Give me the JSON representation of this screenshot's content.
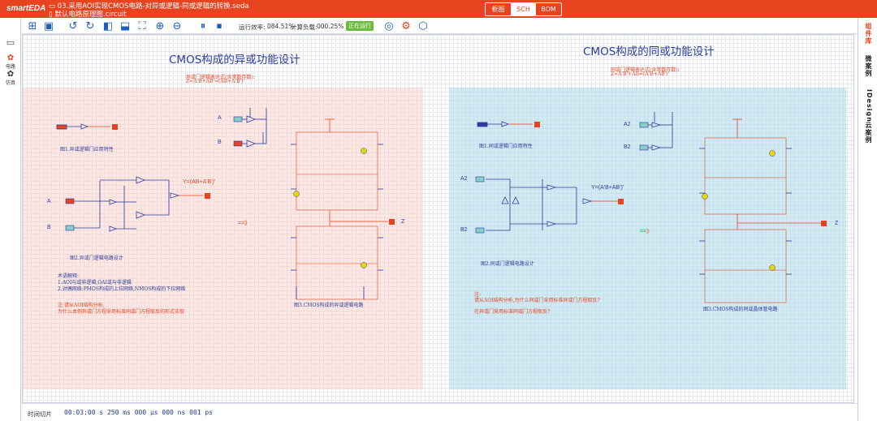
{
  "app": {
    "logo": "smartEDA",
    "file_path": "03.采用AOI实现CMOS电路-对异或逻辑-同或逻辑的转换.seda",
    "circuit_name": "默认电路原理图.circuit",
    "accent": "#e8431f"
  },
  "modes": [
    "框图",
    "SCH",
    "BOM"
  ],
  "toolbar": {
    "icons": [
      "new-file-icon",
      "save-icon",
      "rotate-ccw-icon",
      "rotate-cw-icon",
      "flip-h-icon",
      "flip-v-icon",
      "fit-icon",
      "zoom-in-icon",
      "zoom-out-icon",
      "pause-icon",
      "stop-icon",
      "settings-icon",
      "robot-icon",
      "cube-icon"
    ],
    "efficiency_label": "运行效率:",
    "efficiency_value": "084.51%",
    "load_label": "计算负载:",
    "load_value": "000.25%",
    "run_status": "正在运行"
  },
  "leftbar": {
    "items": [
      {
        "label": ""
      },
      {
        "label": "电路"
      },
      {
        "label": "仿真"
      }
    ]
  },
  "rightbar": {
    "items": [
      "组件库",
      "微案例",
      "IDesign",
      "云案例"
    ]
  },
  "left_panel": {
    "title": "CMOS构成的异或功能设计",
    "expr_label": "异或门逻辑表达式(含常数存数):",
    "expr": "Z=A'B+AB'=(AB+A'B')'",
    "fig1": "图1.异或逻辑门应用特性",
    "fig2": "图2.异或门逻辑电路设计",
    "fig3": "图3.CMOS构成的异或逻辑电路",
    "y_label": "Y=(AB+A'B')'",
    "arrow": "==》",
    "sig_a": "A",
    "sig_b": "B",
    "sig_z": "Z",
    "one": "1",
    "note_title": "术语解释:",
    "note1": "1.AOI与或非逻辑,OAI或与非逻辑",
    "note2": "2.对偶网络:PMOS构成的上拉网络,NMOS构成的下拉网络",
    "note3": "注:请从AOI结构分析,",
    "note4": "为什么本例异或门方程采用标准同或门方程取反的形式实现"
  },
  "right_panel": {
    "title": "CMOS构成的同或功能设计",
    "expr_label": "同或门逻辑表达式(含常数存数):",
    "expr": "Z=A'B'+AB=(A'B+AB')'",
    "fig1": "图1.同或逻辑门应用特性",
    "fig2": "图2.同或门逻辑电路设计",
    "fig3": "图3.CMOS构成的同或晶体管电路",
    "y_label": "Y=(A'B+AB')'",
    "arrow": "==》",
    "sig_a": "A2",
    "sig_b": "B2",
    "sig_z": "Z",
    "one": "1",
    "q_title": "注:",
    "q1": "请从AOI结构分析,为什么同或门采用标准异或门方程取反?",
    "q2": "在异或门采用标准同或门方程取反?"
  },
  "bottom": {
    "time_label": "时间切片",
    "time_value": "00:03:00 s 250 ms 000 μs 000 ns 001 ps"
  }
}
